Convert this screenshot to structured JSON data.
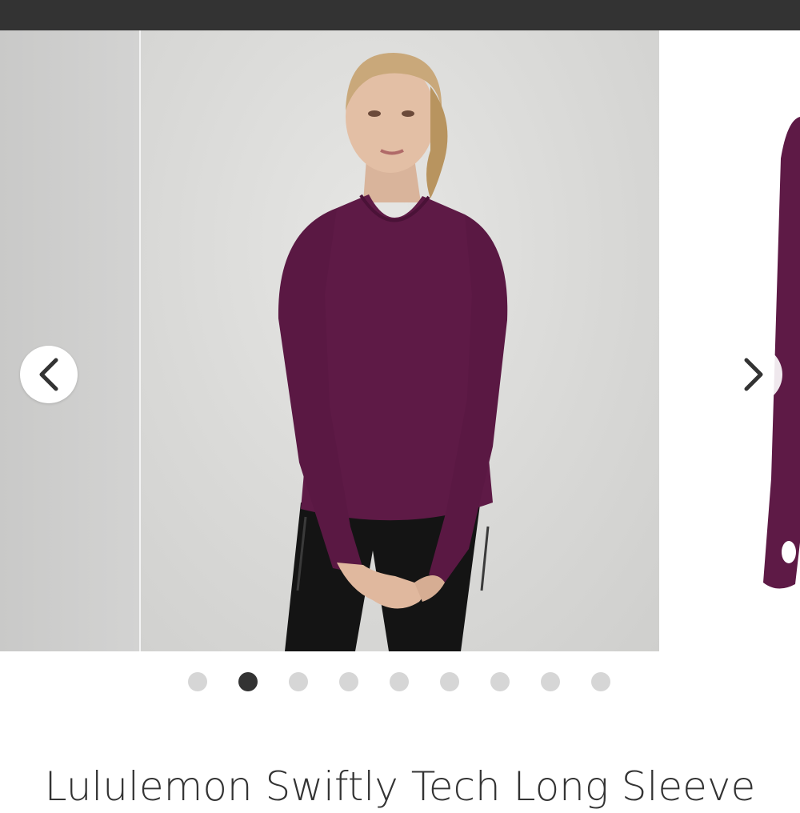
{
  "product": {
    "title": "Lululemon Swiftly Tech Long Sleeve"
  },
  "carousel": {
    "total_slides": 9,
    "active_index": 1,
    "prev_icon": "chevron-left-icon",
    "next_icon": "chevron-right-icon",
    "colors": {
      "garment": "#5e1a46",
      "leggings": "#141414",
      "backdrop": "#d9d9d7"
    }
  }
}
